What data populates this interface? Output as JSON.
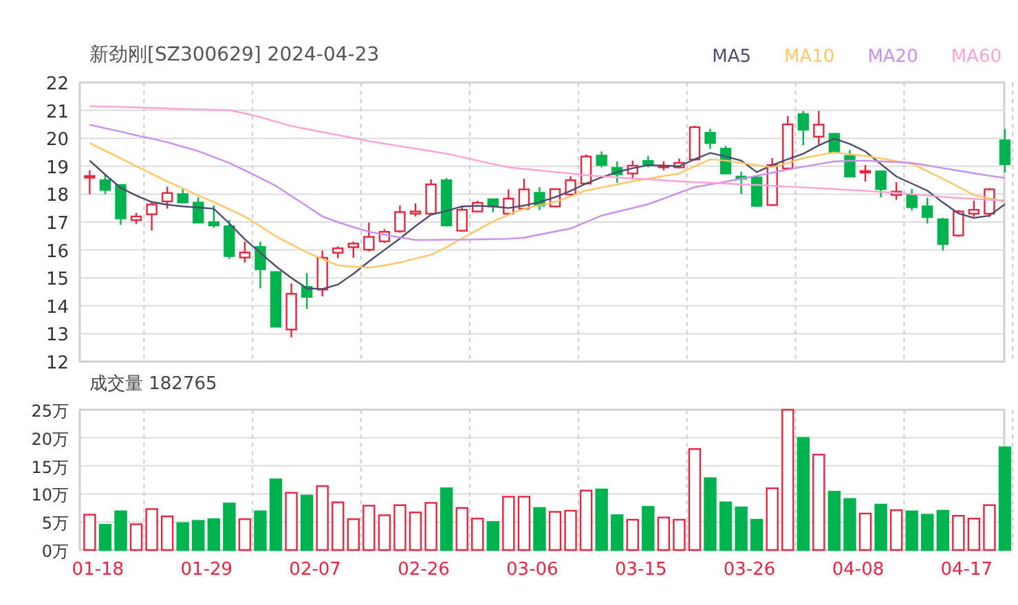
{
  "title": "新劲刚[SZ300629] 2024-04-23",
  "price_chart": {
    "chart_data": {
      "type": "candlestick",
      "grid": true,
      "ylim": [
        12,
        22
      ],
      "yticks": [
        12,
        13,
        14,
        15,
        16,
        17,
        18,
        19,
        20,
        21,
        22
      ],
      "categories": [
        null,
        null,
        null,
        null,
        null,
        null,
        null,
        null,
        null,
        null,
        null,
        null,
        null,
        null,
        null,
        null,
        null,
        null,
        null,
        null,
        null,
        null,
        null,
        null,
        null,
        null,
        null,
        null,
        null,
        null,
        null,
        null,
        null,
        null,
        null,
        null,
        null,
        null,
        null,
        null,
        null,
        null,
        null,
        null,
        null,
        null,
        null,
        null,
        null,
        null,
        null,
        null,
        null,
        null,
        null,
        null,
        null,
        null,
        null,
        null
      ],
      "ohlc": [
        [
          18.6,
          18.85,
          18.0,
          18.65
        ],
        [
          18.5,
          18.7,
          18.0,
          18.15
        ],
        [
          18.33,
          18.33,
          16.9,
          17.13
        ],
        [
          17.07,
          17.33,
          16.93,
          17.2
        ],
        [
          17.28,
          17.72,
          16.7,
          17.63
        ],
        [
          17.74,
          18.27,
          17.48,
          18.04
        ],
        [
          18.0,
          18.18,
          17.7,
          17.7
        ],
        [
          17.7,
          17.89,
          16.98,
          16.98
        ],
        [
          17.0,
          17.6,
          16.8,
          16.88
        ],
        [
          16.85,
          17.07,
          15.68,
          15.78
        ],
        [
          15.73,
          16.3,
          15.55,
          15.91
        ],
        [
          16.11,
          16.3,
          14.63,
          15.31
        ],
        [
          15.21,
          15.21,
          13.25,
          13.25
        ],
        [
          13.15,
          14.8,
          12.87,
          14.43
        ],
        [
          14.68,
          15.17,
          13.89,
          14.32
        ],
        [
          14.58,
          15.98,
          14.34,
          15.72
        ],
        [
          15.9,
          16.13,
          15.7,
          16.06
        ],
        [
          16.1,
          16.3,
          15.72,
          16.23
        ],
        [
          16.01,
          16.98,
          15.95,
          16.47
        ],
        [
          16.31,
          16.75,
          16.25,
          16.65
        ],
        [
          16.67,
          17.59,
          16.62,
          17.36
        ],
        [
          17.3,
          17.67,
          17.2,
          17.38
        ],
        [
          17.3,
          18.53,
          17.25,
          18.35
        ],
        [
          18.5,
          18.58,
          16.84,
          16.88
        ],
        [
          16.69,
          17.56,
          16.65,
          17.44
        ],
        [
          17.38,
          17.76,
          17.34,
          17.69
        ],
        [
          17.82,
          17.82,
          17.35,
          17.56
        ],
        [
          17.3,
          18.17,
          17.27,
          17.84
        ],
        [
          17.48,
          18.55,
          17.45,
          18.17
        ],
        [
          18.05,
          18.25,
          17.43,
          17.59
        ],
        [
          17.56,
          18.18,
          17.53,
          18.18
        ],
        [
          17.99,
          18.64,
          17.95,
          18.5
        ],
        [
          18.38,
          19.42,
          18.35,
          19.35
        ],
        [
          19.38,
          19.53,
          18.96,
          19.04
        ],
        [
          18.94,
          19.17,
          18.41,
          18.71
        ],
        [
          18.74,
          19.2,
          18.52,
          19.02
        ],
        [
          19.19,
          19.37,
          18.96,
          19.07
        ],
        [
          18.98,
          19.18,
          18.85,
          19.02
        ],
        [
          18.96,
          19.27,
          18.92,
          19.12
        ],
        [
          19.24,
          20.45,
          19.2,
          20.4
        ],
        [
          20.2,
          20.34,
          19.62,
          19.83
        ],
        [
          19.63,
          19.73,
          18.7,
          18.74
        ],
        [
          18.63,
          18.8,
          18.0,
          18.55
        ],
        [
          18.6,
          18.66,
          17.55,
          17.58
        ],
        [
          17.61,
          19.29,
          17.58,
          19.04
        ],
        [
          18.92,
          20.8,
          18.88,
          20.5
        ],
        [
          20.87,
          20.98,
          19.75,
          20.31
        ],
        [
          20.06,
          20.98,
          19.78,
          20.49
        ],
        [
          20.16,
          20.2,
          19.45,
          19.5
        ],
        [
          19.37,
          19.58,
          18.6,
          18.63
        ],
        [
          18.78,
          19.04,
          18.45,
          18.83
        ],
        [
          18.82,
          18.85,
          17.89,
          18.18
        ],
        [
          17.97,
          18.43,
          17.8,
          18.09
        ],
        [
          17.97,
          18.18,
          17.41,
          17.53
        ],
        [
          17.56,
          17.87,
          16.95,
          17.18
        ],
        [
          17.1,
          17.15,
          15.98,
          16.21
        ],
        [
          16.52,
          17.43,
          16.47,
          17.38
        ],
        [
          17.3,
          17.77,
          17.2,
          17.44
        ],
        [
          17.3,
          18.22,
          17.18,
          18.17
        ],
        [
          19.93,
          20.34,
          18.78,
          19.07
        ]
      ],
      "series": [
        {
          "name": "MA5",
          "type": "line",
          "color": "#4d4b70",
          "values": [
            19.2,
            18.7,
            18.22,
            17.95,
            17.72,
            17.62,
            17.56,
            17.52,
            17.48,
            16.95,
            16.38,
            15.9,
            15.42,
            15.0,
            14.63,
            14.6,
            14.76,
            15.15,
            15.59,
            16.0,
            16.41,
            16.85,
            17.26,
            17.4,
            17.56,
            17.58,
            17.56,
            17.5,
            17.59,
            17.72,
            17.89,
            18.12,
            18.38,
            18.6,
            18.79,
            18.93,
            19.04,
            19.02,
            19.0,
            19.25,
            19.48,
            19.35,
            19.2,
            18.79,
            19.04,
            19.25,
            19.45,
            19.75,
            19.99,
            19.8,
            19.53,
            19.08,
            18.63,
            18.38,
            18.13,
            17.7,
            17.31,
            17.15,
            17.23,
            17.64
          ]
        },
        {
          "name": "MA10",
          "type": "line",
          "color": "#ffc766",
          "values": [
            19.83,
            19.55,
            19.28,
            19.0,
            18.73,
            18.46,
            18.2,
            17.95,
            17.72,
            17.46,
            17.2,
            16.85,
            16.49,
            16.2,
            15.91,
            15.68,
            15.45,
            15.4,
            15.37,
            15.45,
            15.55,
            15.69,
            15.83,
            16.1,
            16.41,
            16.72,
            17.02,
            17.26,
            17.48,
            17.6,
            17.72,
            17.92,
            18.13,
            18.24,
            18.35,
            18.46,
            18.55,
            18.65,
            18.74,
            19.0,
            19.25,
            19.2,
            19.12,
            19.04,
            18.96,
            19.12,
            19.29,
            19.4,
            19.5,
            19.43,
            19.37,
            19.28,
            19.18,
            19.09,
            18.82,
            18.55,
            18.26,
            17.97,
            17.85,
            17.72
          ]
        },
        {
          "name": "MA20",
          "type": "line",
          "color": "#c890ec",
          "values": [
            20.49,
            20.36,
            20.24,
            20.11,
            19.99,
            19.86,
            19.7,
            19.54,
            19.33,
            19.12,
            18.85,
            18.58,
            18.3,
            17.93,
            17.57,
            17.2,
            17.0,
            16.82,
            16.65,
            16.55,
            16.45,
            16.36,
            16.36,
            16.37,
            16.37,
            16.38,
            16.39,
            16.4,
            16.44,
            16.55,
            16.66,
            16.77,
            17.0,
            17.23,
            17.37,
            17.5,
            17.64,
            17.84,
            18.05,
            18.25,
            18.35,
            18.45,
            18.55,
            18.66,
            18.77,
            18.88,
            18.98,
            19.08,
            19.17,
            19.19,
            19.2,
            19.17,
            19.15,
            19.12,
            19.03,
            18.93,
            18.84,
            18.75,
            18.66,
            18.58
          ]
        },
        {
          "name": "MA60",
          "type": "line",
          "color": "#ffa3d2",
          "values": [
            21.15,
            21.14,
            21.13,
            21.11,
            21.09,
            21.07,
            21.05,
            21.04,
            21.02,
            21.01,
            20.89,
            20.76,
            20.6,
            20.44,
            20.33,
            20.22,
            20.12,
            20.01,
            19.9,
            19.81,
            19.72,
            19.63,
            19.54,
            19.45,
            19.33,
            19.2,
            19.08,
            18.96,
            18.9,
            18.85,
            18.79,
            18.74,
            18.68,
            18.64,
            18.6,
            18.56,
            18.53,
            18.5,
            18.46,
            18.43,
            18.41,
            18.38,
            18.35,
            18.33,
            18.3,
            18.27,
            18.24,
            18.21,
            18.18,
            18.15,
            18.12,
            18.08,
            18.05,
            18.0,
            17.95,
            17.9,
            17.86,
            17.83,
            17.8,
            17.77
          ]
        }
      ]
    }
  },
  "volume_chart": {
    "chart_data": {
      "type": "bar",
      "title": "成交量 182765",
      "grid": true,
      "ylim": [
        0,
        25
      ],
      "yticks": [
        {
          "value": 0,
          "label": "0万"
        },
        {
          "value": 5,
          "label": "5万"
        },
        {
          "value": 10,
          "label": "10万"
        },
        {
          "value": 15,
          "label": "15万"
        },
        {
          "value": 20,
          "label": "20万"
        },
        {
          "value": 25,
          "label": "25万"
        }
      ],
      "categories": [
        "01-18",
        null,
        null,
        null,
        null,
        null,
        null,
        "01-29",
        null,
        null,
        null,
        null,
        null,
        null,
        "02-07",
        null,
        null,
        null,
        null,
        null,
        null,
        "02-26",
        null,
        null,
        null,
        null,
        null,
        null,
        "03-06",
        null,
        null,
        null,
        null,
        null,
        null,
        "03-15",
        null,
        null,
        null,
        null,
        null,
        null,
        "03-26",
        null,
        null,
        null,
        null,
        null,
        null,
        "04-08",
        null,
        null,
        null,
        null,
        null,
        null,
        "04-17",
        null,
        null,
        null
      ],
      "values": [
        6.3,
        4.5,
        6.9,
        4.6,
        7.3,
        6.0,
        4.8,
        5.2,
        5.5,
        8.3,
        5.5,
        6.9,
        12.6,
        10.2,
        9.7,
        11.4,
        8.5,
        5.5,
        7.9,
        6.2,
        8.0,
        6.7,
        8.4,
        11.0,
        7.5,
        5.6,
        5.0,
        9.5,
        9.5,
        7.5,
        6.8,
        7.0,
        10.6,
        10.8,
        6.2,
        5.4,
        7.7,
        5.8,
        5.4,
        18.0,
        12.8,
        8.5,
        7.6,
        5.4,
        11.0,
        25.0,
        20.0,
        17.0,
        10.4,
        9.1,
        6.5,
        8.1,
        7.1,
        6.9,
        6.3,
        7.0,
        6.1,
        5.6,
        8.0,
        18.3
      ]
    }
  }
}
